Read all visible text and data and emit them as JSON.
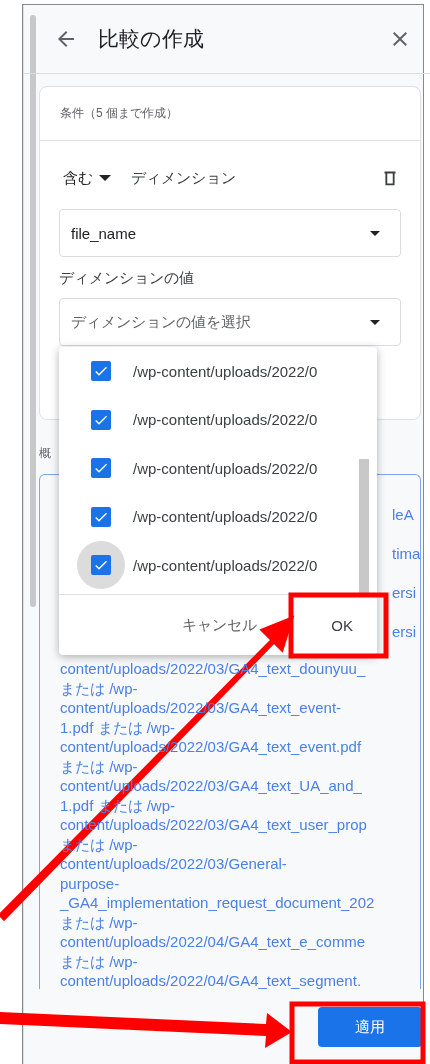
{
  "header": {
    "title": "比較の作成"
  },
  "condition_card": {
    "heading": "条件（5 個まで作成）",
    "operator": "含む",
    "dimension_label": "ディメンション",
    "dimension_select": {
      "value": "file_name"
    },
    "value_label": "ディメンションの値",
    "value_select": {
      "placeholder": "ディメンションの値を選択"
    }
  },
  "dropdown": {
    "options": [
      {
        "label": "/wp-content/uploads/2022/0",
        "checked": true,
        "focused": false
      },
      {
        "label": "/wp-content/uploads/2022/0",
        "checked": true,
        "focused": false
      },
      {
        "label": "/wp-content/uploads/2022/0",
        "checked": true,
        "focused": false
      },
      {
        "label": "/wp-content/uploads/2022/0",
        "checked": true,
        "focused": false
      },
      {
        "label": "/wp-content/uploads/2022/0",
        "checked": true,
        "focused": true
      }
    ],
    "cancel": "キャンセル",
    "ok": "OK"
  },
  "summary": {
    "label": "概",
    "covered_line_ends": [
      "leA",
      "tima",
      "ersi",
      "ersi"
    ],
    "lines": [
      "content/uploads/2022/03/GA4_text_dounyuu_",
      "または /wp-",
      "content/uploads/2022/03/GA4_text_event-",
      "1.pdf または /wp-",
      "content/uploads/2022/03/GA4_text_event.pdf",
      "または /wp-",
      "content/uploads/2022/03/GA4_text_UA_and_",
      "1.pdf または /wp-",
      "content/uploads/2022/03/GA4_text_user_prop",
      "または /wp-",
      "content/uploads/2022/03/General-",
      "purpose-",
      "_GA4_implementation_request_document_202",
      "または /wp-",
      "content/uploads/2022/04/GA4_text_e_comme",
      "または /wp-",
      "content/uploads/2022/04/GA4_text_segment."
    ]
  },
  "apply_button": "適用"
}
